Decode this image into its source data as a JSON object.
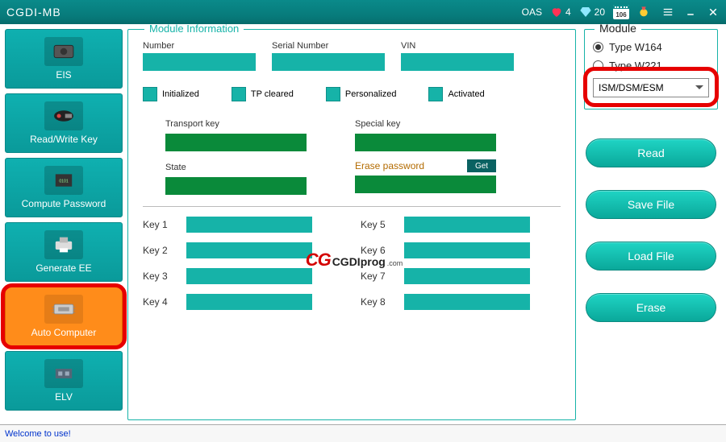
{
  "title": "CGDI-MB",
  "titlebar": {
    "oas_label": "OAS",
    "heart_count": "4",
    "diamond_count": "20",
    "calendar_value": "106"
  },
  "sidebar": {
    "items": [
      {
        "label": "EIS"
      },
      {
        "label": "Read/Write Key"
      },
      {
        "label": "Compute Password"
      },
      {
        "label": "Generate EE"
      },
      {
        "label": "Auto Computer"
      },
      {
        "label": "ELV"
      }
    ]
  },
  "center": {
    "legend": "Module Information",
    "number_label": "Number",
    "serial_label": "Serial Number",
    "vin_label": "VIN",
    "initialized": "Initialized",
    "tp_cleared": "TP cleared",
    "personalized": "Personalized",
    "activated": "Activated",
    "transport_key": "Transport key",
    "special_key": "Special key",
    "state": "State",
    "erase_password": "Erase password",
    "get": "Get",
    "keys_left": [
      "Key 1",
      "Key 2",
      "Key 3",
      "Key 4"
    ],
    "keys_right": [
      "Key 5",
      "Key 6",
      "Key 7",
      "Key 8"
    ]
  },
  "logo": {
    "cg": "CG",
    "rest": "CGDIprog",
    "com": ".com"
  },
  "right": {
    "legend": "Module",
    "radio1": "Type W164",
    "radio2": "Type W221",
    "combo": "ISM/DSM/ESM",
    "read": "Read",
    "save": "Save File",
    "load": "Load File",
    "erase": "Erase"
  },
  "status": "Welcome to use!"
}
